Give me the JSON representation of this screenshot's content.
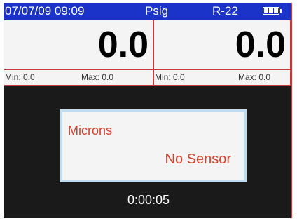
{
  "header": {
    "datetime": "07/07/09 09:09",
    "unit": "Psig",
    "refrigerant": "R-22",
    "battery_icon": "battery-full-icon"
  },
  "left_gauge": {
    "reading": "0.0",
    "min_label": "Min: 0.0",
    "max_label": "Max: 0.0"
  },
  "right_gauge": {
    "reading": "0.0",
    "min_label": "Min: 0.0",
    "max_label": "Max: 0.0"
  },
  "vacuum": {
    "title": "Microns",
    "status": "No Sensor"
  },
  "timer": "0:00:05",
  "colors": {
    "header_bg": "#1b33c8",
    "accent_red": "#d8412c",
    "screen_bg": "#1a1a1a"
  }
}
